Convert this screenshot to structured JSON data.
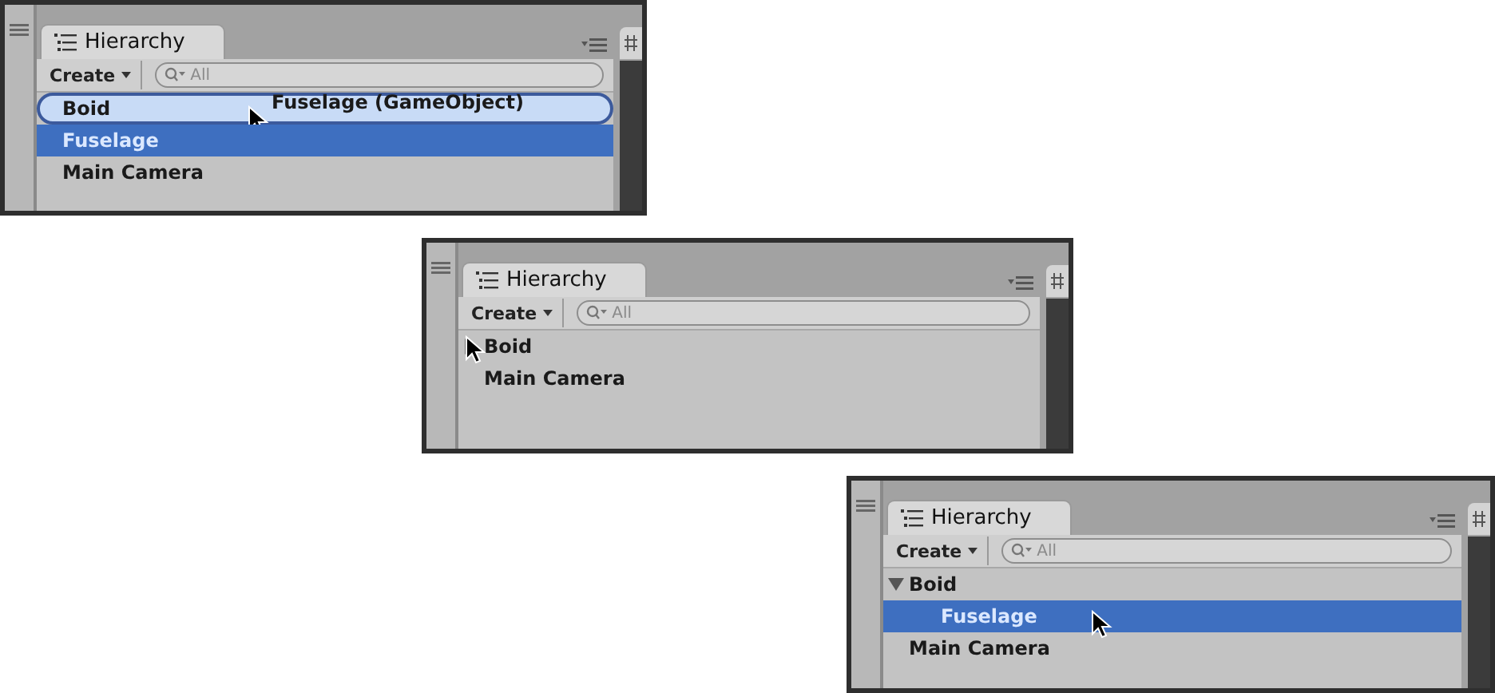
{
  "panels": [
    {
      "tab": "Hierarchy",
      "create": "Create",
      "search": {
        "placeholder": "All"
      },
      "drag_label": "Fuselage (GameObject)",
      "rows": [
        {
          "label": "Boid",
          "selected": false,
          "drop_target": true,
          "hovered": true
        },
        {
          "label": "Fuselage",
          "selected": true,
          "drop_target": false,
          "hovered": false
        },
        {
          "label": "Main Camera",
          "selected": false,
          "drop_target": false,
          "hovered": false
        }
      ]
    },
    {
      "tab": "Hierarchy",
      "create": "Create",
      "search": {
        "placeholder": "All"
      },
      "rows": [
        {
          "label": "Boid",
          "selected": false,
          "drop_target": false,
          "hovered": true,
          "expanded": false
        },
        {
          "label": "Main Camera",
          "selected": false,
          "drop_target": false,
          "hovered": false
        }
      ]
    },
    {
      "tab": "Hierarchy",
      "create": "Create",
      "search": {
        "placeholder": "All"
      },
      "rows": [
        {
          "label": "Boid",
          "selected": false,
          "drop_target": false,
          "hovered": false,
          "expanded": true,
          "children": [
            {
              "label": "Fuselage",
              "selected": true,
              "drop_target": false,
              "hovered": true
            }
          ]
        },
        {
          "label": "Main Camera",
          "selected": false,
          "drop_target": false,
          "hovered": false
        }
      ]
    }
  ]
}
